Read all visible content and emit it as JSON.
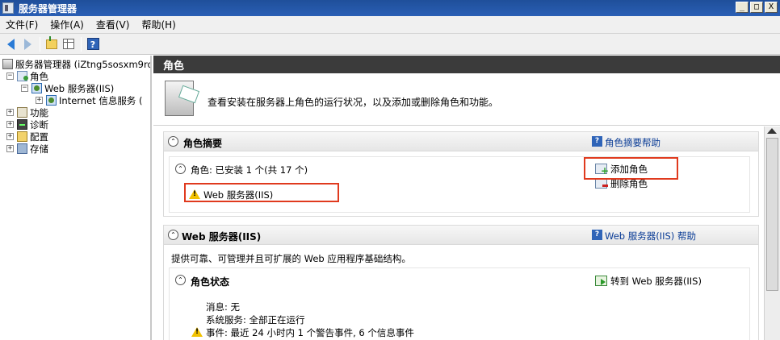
{
  "window": {
    "title": "服务器管理器",
    "buttons": {
      "minimize": "_",
      "restore": "□",
      "close": "X"
    }
  },
  "menu": [
    "文件(F)",
    "操作(A)",
    "查看(V)",
    "帮助(H)"
  ],
  "toolbar": {
    "icons": [
      "back-arrow-icon",
      "forward-arrow-icon",
      "up-folder-icon",
      "show-hide-tree-icon",
      "help-icon"
    ]
  },
  "tree": {
    "root": "服务器管理器 (iZtng5sosxm9rd",
    "roles": "角色",
    "web_server": "Web 服务器(IIS)",
    "iis_manager": "Internet 信息服务 (",
    "features": "功能",
    "diagnostics": "诊断",
    "configuration": "配置",
    "storage": "存储"
  },
  "header": {
    "title": "角色"
  },
  "intro": {
    "text": "查看安装在服务器上角色的运行状况，以及添加或删除角色和功能。"
  },
  "roles_summary": {
    "title": "角色摘要",
    "help_link": "角色摘要帮助",
    "roles_line": "角色: 已安装 1 个(共 17 个)",
    "installed_role": "Web 服务器(IIS)",
    "add_roles": "添加角色",
    "remove_roles": "删除角色"
  },
  "web_section": {
    "title": "Web 服务器(IIS)",
    "help_link": "Web 服务器(IIS) 帮助",
    "description": "提供可靠、可管理并且可扩展的 Web 应用程序基础结构。",
    "role_status_title": "角色状态",
    "goto_link": "转到 Web 服务器(IIS)",
    "messages": "消息: 无",
    "system_services": "系统服务: 全部正在运行",
    "events": "事件: 最近 24 小时内 1 个警告事件, 6 个信息事件"
  },
  "colors": {
    "header_bg": "#3b3b3b",
    "title_bar": "#2a5fb5",
    "highlight_box": "#e03a1e",
    "link": "#0a3c96"
  }
}
